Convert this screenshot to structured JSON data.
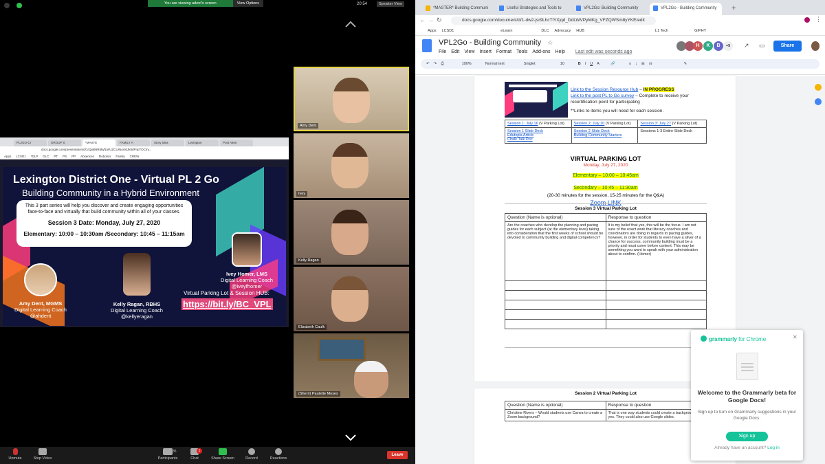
{
  "zoom": {
    "banner": "You are viewing adent's screen",
    "view_options": "View Options",
    "time": "20:54",
    "speaker_view": "Speaker View",
    "toolbar": {
      "unmute": "Unmute",
      "stop_video": "Stop Video",
      "participants": "Participants",
      "participants_count": "35",
      "chat": "Chat",
      "chat_badge": "1",
      "share_screen": "Share Screen",
      "record": "Record",
      "reactions": "Reactions",
      "leave": "Leave"
    },
    "participants": [
      {
        "name": "Amy Dent"
      },
      {
        "name": "Ivey"
      },
      {
        "name": "Kelly Ragan"
      },
      {
        "name": "Elizabeth Caulk"
      },
      {
        "name": "(Sherri) Paulette Moses"
      }
    ]
  },
  "shared_browser": {
    "tabs": [
      "PL2GO-Cr",
      "GROUP S",
      "*MASTE",
      "FAMILY A",
      "Story Idea",
      "Lexington",
      "Post Atten"
    ],
    "url": "docs.google.com/presentation/d/1rQwB6R5kyfLWUZCUINom0Jk8dPnpTOCtry...",
    "bookmarks": [
      "Apps",
      "LCSD1",
      "*DLP",
      "DLC",
      "PT",
      "PS",
      "PP",
      "Absences",
      "Robotics",
      "Family",
      "CREW"
    ]
  },
  "slide": {
    "title": "Lexington District One - Virtual PL 2 Go",
    "subtitle": "Building Community in a Hybrid Environment",
    "description": "This 3 part series will help you discover and create engaging opportunities face-to-face and virtually that build community within all of your classes.",
    "session_date": "Session 3 Date: Monday, July 27, 2020",
    "times": "Elementary: 10:00 – 10:30am /Secondary: 10:45 – 11:15am",
    "presenters": [
      {
        "name": "Amy Dent, MGMS",
        "role": "Digital Learning Coach",
        "handle": "@ahdent"
      },
      {
        "name": "Kelly Ragan, RBHS",
        "role": "Digital Learning Coach",
        "handle": "@kellyeragan"
      },
      {
        "name": "Ivey Homer, LMS",
        "role": "Digital Learning Coach",
        "handle": "@iveyfhomer"
      }
    ],
    "hub_label": "Virtual Parking Lot & Session HUB:",
    "hub_link": "https://bit.ly/BC_VPL"
  },
  "chrome": {
    "tabs": [
      "*MASTER* Building Communi",
      "Useful Strategies and Tools to",
      "VPL2Go: Building Community",
      "VPL2Go - Building Community"
    ],
    "url": "docs.google.com/document/d/1-dw2-jsr9LhcTlYXjqd_DdLWVPyMKg_VFZQWSm8yYKE/edit",
    "bookmarks": [
      "Apps",
      "LCSD1",
      "eLearn",
      "DLC",
      "Advocacy",
      "HUB",
      "L1 Tech",
      "GIPHY"
    ]
  },
  "gdoc": {
    "title": "VPL2Go - Building Community",
    "menu": [
      "File",
      "Edit",
      "View",
      "Insert",
      "Format",
      "Tools",
      "Add-ons",
      "Help"
    ],
    "last_edit": "Last edit was seconds ago",
    "share": "Share",
    "collaborators": [
      "H",
      "K",
      "B"
    ],
    "more_collaborators": "+5",
    "toolbar": {
      "zoom": "100%",
      "style": "Normal text",
      "font": "Sniglet",
      "size": "10"
    },
    "links_block": {
      "hub_link": "Link to the Session Resource Hub",
      "hub_status": "IN PROGRESS",
      "survey_link": "Link to the post PL to Go survey",
      "survey_text": " – Complete to receive your recertification point for participating",
      "note": "**Links to items you will need for each session."
    },
    "sessions_table": [
      {
        "link": "Session 1: July 16",
        "suffix": " (V Parking Lot)",
        "items": [
          "Session 1 Slide Deck",
          "Edutopia Article",
          "Chalk Talk Doc"
        ]
      },
      {
        "link": "Session 2: July 20",
        "suffix": " (V Parking Lot)",
        "items": [
          "Session 2 Slide Deck",
          "Building Community Starters"
        ]
      },
      {
        "link": "Session 3: July 27",
        "suffix": " (V Parking Lot)",
        "items": [
          "Sessions 1-3 Entire Slide Deck"
        ]
      }
    ],
    "vpl": {
      "title": "VIRTUAL PARKING LOT",
      "date": "Monday, July 27, 2020",
      "elementary": "Elementary – 10:00 – 10:45am",
      "secondary": "Secondary – 10:45 – 11:30am",
      "note": "(20-30 minutes for the session, 15-25 minutes for the Q&A)",
      "zoom_link": "Zoom LINK"
    },
    "s3": {
      "heading": "Session 3 Virtual Parking Lot",
      "col1": "Question (Name is optional)",
      "col2": "Response to question",
      "q1": "Are the coaches who develop the planning and pacing guides for each subject (at the elementary level) taking into consideration that the first weeks of school should be devoted to community building and digital competency?",
      "a1": "It is my belief that yes, this will be the focus.  I am not sure of the exact work that  literacy coaches and coordinators are doing in regards to pacing guides, however, in order for students to even have a sliver of a chance for success, community building must be a priority and must come before content.  This may be something you want to speak with your administration about to confirm. (Homer)"
    },
    "s2": {
      "heading": "Session 2 Virtual Parking Lot",
      "col1": "Question (Name is optional)",
      "col2": "Response to question",
      "q1": "Christine Rivers – Would students use  Canva to create a Zoom background?",
      "a1": "That is one way students could create a background, yes.  They could also use Google slides."
    }
  },
  "grammarly": {
    "brand": "grammarly",
    "for_chrome": "for Chrome",
    "title": "Welcome to the Grammarly beta for Google Docs!",
    "text": "Sign up to turn on Grammarly suggestions in your Google Docs.",
    "button": "Sign up",
    "login_prompt": "Already have an account?",
    "login_link": "Log in"
  }
}
